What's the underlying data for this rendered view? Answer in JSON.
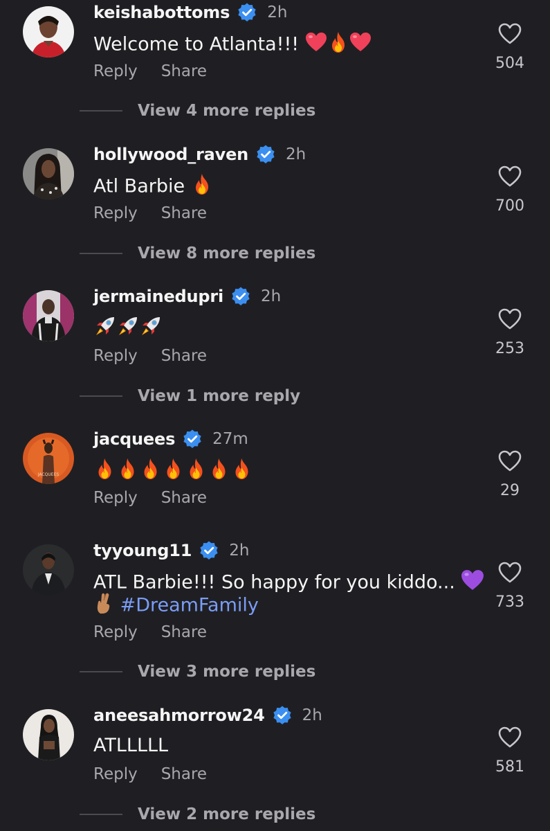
{
  "comments": [
    {
      "username": "keishabottoms",
      "time": "2h",
      "text": "Welcome to Atlanta!!! ",
      "emoji": [
        "heart",
        "fire",
        "heart"
      ],
      "reply_label": "Reply",
      "share_label": "Share",
      "likes": "504",
      "view_replies": "View 4 more replies"
    },
    {
      "username": "hollywood_raven",
      "time": "2h",
      "text": "Atl Barbie ",
      "emoji": [
        "fire"
      ],
      "reply_label": "Reply",
      "share_label": "Share",
      "likes": "700",
      "view_replies": "View 8 more replies"
    },
    {
      "username": "jermainedupri",
      "time": "2h",
      "text": "",
      "emoji": [
        "rocket",
        "rocket",
        "rocket"
      ],
      "reply_label": "Reply",
      "share_label": "Share",
      "likes": "253",
      "view_replies": "View 1 more reply"
    },
    {
      "username": "jacquees",
      "time": "27m",
      "text": "",
      "emoji": [
        "fire",
        "fire",
        "fire",
        "fire",
        "fire",
        "fire",
        "fire"
      ],
      "reply_label": "Reply",
      "share_label": "Share",
      "likes": "29",
      "view_replies": ""
    },
    {
      "username": "tyyoung11",
      "time": "2h",
      "text": "ATL Barbie!!! So happy for you kiddo... ",
      "text_line2_hashtag": "#DreamFamily",
      "emoji": [
        "purple-heart"
      ],
      "emoji_line2": [
        "crossed-fingers"
      ],
      "reply_label": "Reply",
      "share_label": "Share",
      "likes": "733",
      "view_replies": "View 3 more replies"
    },
    {
      "username": "aneesahmorrow24",
      "time": "2h",
      "text": "ATLLLLL",
      "emoji": [],
      "reply_label": "Reply",
      "share_label": "Share",
      "likes": "581",
      "view_replies": "View 2 more replies"
    }
  ],
  "colors": {
    "background": "#1f1f23",
    "verified_badge": "#3b8ff0",
    "hashtag": "#7b9df7",
    "secondary_text": "#a8a8ad"
  },
  "icons": {
    "verified": "verified-badge-icon",
    "like": "heart-outline-icon"
  }
}
